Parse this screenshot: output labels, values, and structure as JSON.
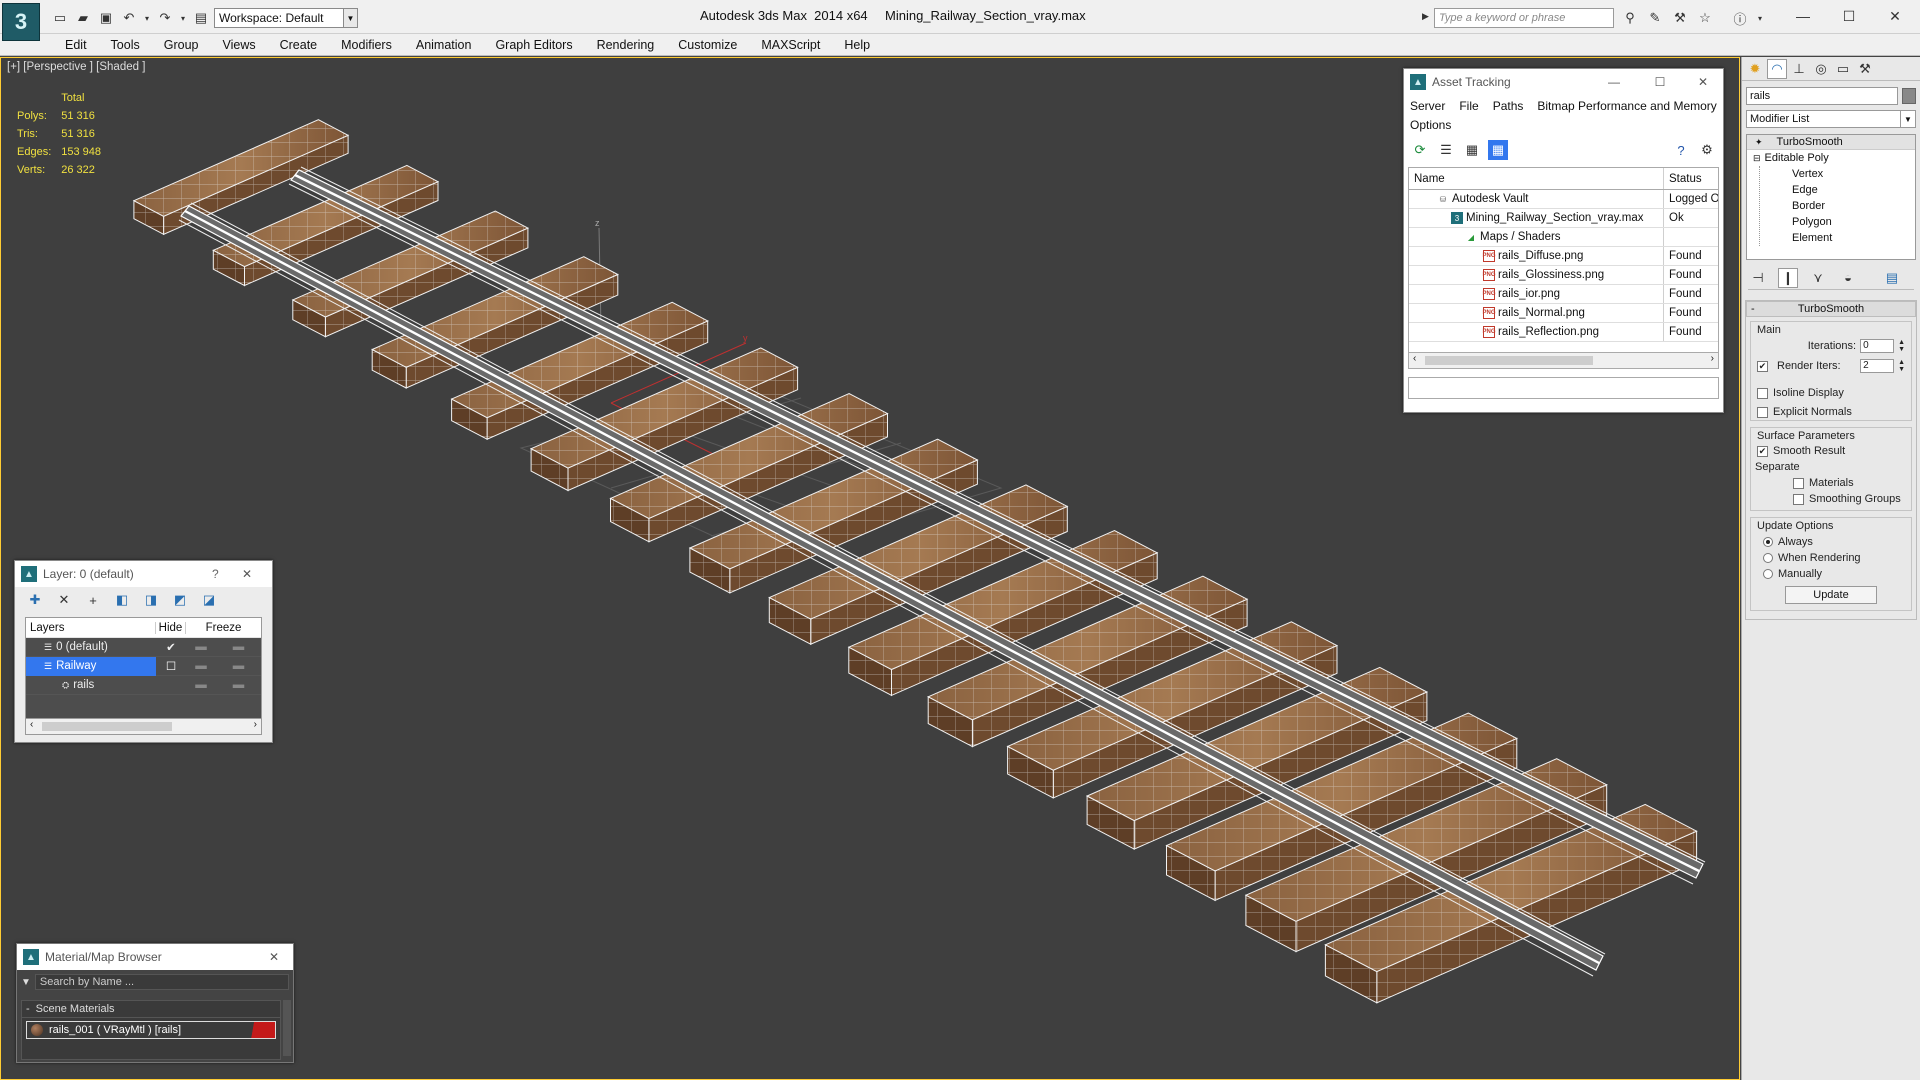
{
  "app": {
    "title": "Autodesk 3ds Max  2014 x64",
    "file": "Mining_Railway_Section_vray.max",
    "logo": "3",
    "workspace": "Workspace: Default",
    "search_placeholder": "Type a keyword or phrase"
  },
  "menu": [
    "Edit",
    "Tools",
    "Group",
    "Views",
    "Create",
    "Modifiers",
    "Animation",
    "Graph Editors",
    "Rendering",
    "Customize",
    "MAXScript",
    "Help"
  ],
  "viewport": {
    "label": "[+] [Perspective ] [Shaded ]",
    "stats": {
      "header": "Total",
      "rows": [
        {
          "label": "Polys:",
          "value": "51 316"
        },
        {
          "label": "Tris:",
          "value": "51 316"
        },
        {
          "label": "Edges:",
          "value": "153 948"
        },
        {
          "label": "Verts:",
          "value": "26 322"
        }
      ]
    },
    "axes": {
      "y": "y",
      "z": "z"
    }
  },
  "asset_tracking": {
    "title": "Asset Tracking",
    "menu": [
      "Server",
      "File",
      "Paths",
      "Bitmap Performance and Memory",
      "Options"
    ],
    "columns": [
      "Name",
      "Status"
    ],
    "rows": [
      {
        "name": "Autodesk Vault",
        "status": "Logged Out",
        "indent": 1,
        "icon": "vault-icon"
      },
      {
        "name": "Mining_Railway_Section_vray.max",
        "status": "Ok",
        "indent": 2,
        "icon": "max-file-icon"
      },
      {
        "name": "Maps / Shaders",
        "status": "",
        "indent": 3,
        "icon": "maps-folder-icon"
      },
      {
        "name": "rails_Diffuse.png",
        "status": "Found",
        "indent": 4,
        "icon": "png-file-icon"
      },
      {
        "name": "rails_Glossiness.png",
        "status": "Found",
        "indent": 4,
        "icon": "png-file-icon"
      },
      {
        "name": "rails_ior.png",
        "status": "Found",
        "indent": 4,
        "icon": "png-file-icon"
      },
      {
        "name": "rails_Normal.png",
        "status": "Found",
        "indent": 4,
        "icon": "png-file-icon"
      },
      {
        "name": "rails_Reflection.png",
        "status": "Found",
        "indent": 4,
        "icon": "png-file-icon"
      }
    ],
    "png_badge": "PNG"
  },
  "layer_panel": {
    "title": "Layer: 0 (default)",
    "help": "?",
    "columns": [
      "Layers",
      "Hide",
      "Freeze"
    ],
    "rows": [
      {
        "name": "0 (default)",
        "selected": false,
        "indent": 1
      },
      {
        "name": "Railway",
        "selected": true,
        "indent": 1
      },
      {
        "name": "rails",
        "selected": false,
        "indent": 2
      }
    ]
  },
  "material_browser": {
    "title": "Material/Map Browser",
    "search_placeholder": "Search by Name ...",
    "section": "Scene Materials",
    "section_toggle": "-",
    "item": "rails_001  ( VRayMtl )  [rails]",
    "swatch_color": "#c41a1a"
  },
  "command_panel": {
    "object_name": "rails",
    "modifier_list": "Modifier List",
    "stack": [
      "TurboSmooth",
      "Editable Poly",
      "Vertex",
      "Edge",
      "Border",
      "Polygon",
      "Element"
    ],
    "rollout_title": "TurboSmooth",
    "rollout_toggle": "-",
    "main": {
      "label": "Main",
      "iterations_label": "Iterations:",
      "iterations": "0",
      "render_iters_label": "Render Iters:",
      "render_iters": "2",
      "render_iters_checked": true,
      "isoline": "Isoline Display",
      "explicit": "Explicit Normals"
    },
    "surface": {
      "label": "Surface Parameters",
      "smooth": "Smooth Result",
      "separate": "Separate",
      "materials": "Materials",
      "smoothing": "Smoothing Groups"
    },
    "update": {
      "label": "Update Options",
      "options": [
        "Always",
        "When Rendering",
        "Manually"
      ],
      "selected": 0,
      "button": "Update"
    }
  },
  "colors": {
    "selection": "#3377ee",
    "viewport_border": "#ffcc33",
    "stats": "#f0e040",
    "tie": "#7a5536"
  }
}
